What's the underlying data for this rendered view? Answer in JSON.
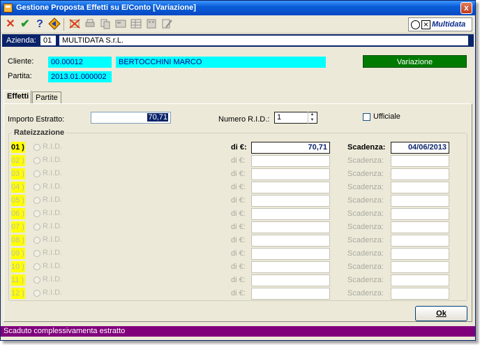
{
  "window": {
    "title": "Gestione Proposta Effetti su E/Conto [Variazione]",
    "close_glyph": "x"
  },
  "toolbar": {
    "icons": [
      "close-x-icon",
      "confirm-check-icon",
      "help-question-icon",
      "navigate-icon",
      "delete-icon",
      "print-icon",
      "copy-icon",
      "export-icon",
      "table-icon",
      "grid-icon",
      "edit-icon"
    ],
    "cancel_glyph": "✕",
    "confirm_glyph": "✔",
    "help_glyph": "?",
    "logo_text": "Multidata"
  },
  "azienda": {
    "label": "Azienda:",
    "code": "01",
    "name": "MULTIDATA S.r.L."
  },
  "cliente": {
    "label": "Cliente:",
    "code": "00.00012",
    "name": "BERTOCCHINI MARCO"
  },
  "partita": {
    "label": "Partita:",
    "value": "2013.01.000002"
  },
  "status_badge": "Variazione",
  "tabs": [
    {
      "label": "Effetti",
      "active": true
    },
    {
      "label": "Partite",
      "active": false
    }
  ],
  "importo": {
    "label": "Importo Estratto:",
    "value": "70,71"
  },
  "numero_rid": {
    "label": "Numero R.I.D.:",
    "value": "1"
  },
  "ufficiale": {
    "label": "Ufficiale",
    "checked": false
  },
  "rateizzazione": {
    "title": "Rateizzazione",
    "radio_label": "R.I.D.",
    "amount_label": "di €:",
    "due_label": "Scadenza:",
    "rows": [
      {
        "num": "01 )",
        "amount": "70,71",
        "due": "04/06/2013",
        "enabled": true
      },
      {
        "num": "02 )",
        "amount": "",
        "due": "",
        "enabled": false
      },
      {
        "num": "03 )",
        "amount": "",
        "due": "",
        "enabled": false
      },
      {
        "num": "04 )",
        "amount": "",
        "due": "",
        "enabled": false
      },
      {
        "num": "05 )",
        "amount": "",
        "due": "",
        "enabled": false
      },
      {
        "num": "06 )",
        "amount": "",
        "due": "",
        "enabled": false
      },
      {
        "num": "07 )",
        "amount": "",
        "due": "",
        "enabled": false
      },
      {
        "num": "08 )",
        "amount": "",
        "due": "",
        "enabled": false
      },
      {
        "num": "09 )",
        "amount": "",
        "due": "",
        "enabled": false
      },
      {
        "num": "10 )",
        "amount": "",
        "due": "",
        "enabled": false
      },
      {
        "num": "11 )",
        "amount": "",
        "due": "",
        "enabled": false
      },
      {
        "num": "12 )",
        "amount": "",
        "due": "",
        "enabled": false
      }
    ]
  },
  "ok_button": "Ok",
  "statusbar": "Scaduto complessivamenta estratto",
  "colors": {
    "title_bar": "#0a5fd8",
    "azienda_bar": "#0a246a",
    "highlight_cyan": "#00ffff",
    "status_green": "#007a00",
    "row_number_yellow": "#ffff00",
    "status_bar_purple": "#80007c"
  }
}
